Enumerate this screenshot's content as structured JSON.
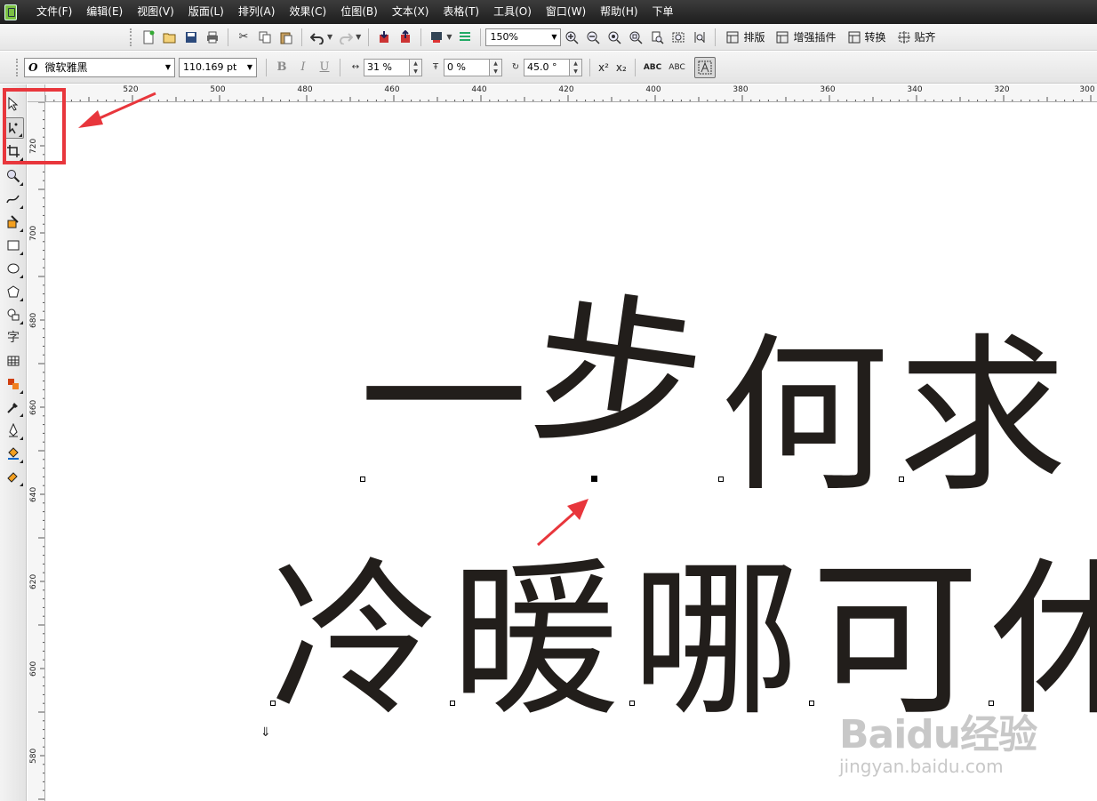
{
  "menu": [
    "文件(F)",
    "编辑(E)",
    "视图(V)",
    "版面(L)",
    "排列(A)",
    "效果(C)",
    "位图(B)",
    "文本(X)",
    "表格(T)",
    "工具(O)",
    "窗口(W)",
    "帮助(H)",
    "下单"
  ],
  "toolbar": {
    "zoom_value": "150%",
    "labels": {
      "layout": "排版",
      "plugins": "增强插件",
      "convert": "转换",
      "snap": "贴齐"
    }
  },
  "property_bar": {
    "font_name": "微软雅黑",
    "font_size": "110.169 pt",
    "bold": "B",
    "italic": "I",
    "underline": "U",
    "char_spacing": "31 %",
    "line_spacing": "0 %",
    "angle": "45.0 °",
    "superscript": "x²",
    "subscript": "x₂",
    "small_caps": "ABC",
    "all_caps": "ABC"
  },
  "toolbox_text_tool": "字",
  "rulers": {
    "horizontal": [
      "520",
      "500",
      "480",
      "460",
      "440",
      "420",
      "400",
      "380",
      "360",
      "340",
      "320",
      "300"
    ],
    "vertical": [
      "720",
      "700",
      "680",
      "660",
      "640",
      "620",
      "600",
      "580"
    ]
  },
  "canvas_text": {
    "line1": [
      "一",
      "步",
      "何",
      "求"
    ],
    "line2": [
      "冷",
      "暖",
      "哪",
      "可",
      "休"
    ]
  },
  "watermark": {
    "brand": "Baidu经验",
    "url": "jingyan.baidu.com"
  },
  "colors": {
    "annotation": "#e8363c",
    "text": "#221e1b",
    "menubar": "#2b2b2b"
  }
}
